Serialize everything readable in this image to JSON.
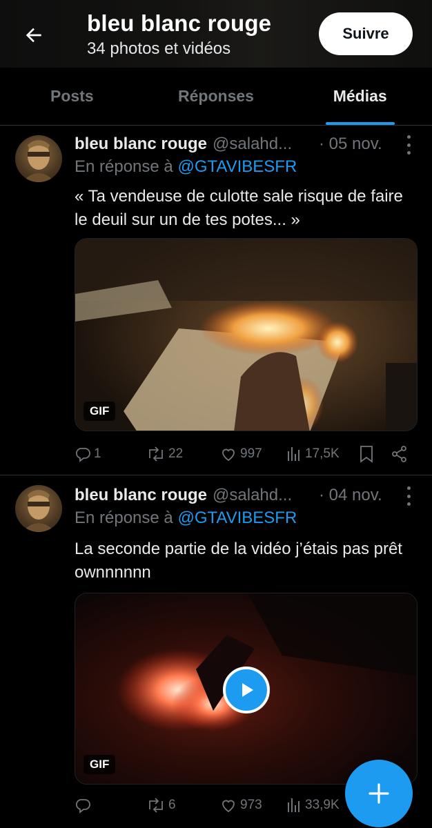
{
  "header": {
    "title": "bleu blanc rouge",
    "subtitle": "34 photos et vidéos",
    "follow_label": "Suivre"
  },
  "tabs": [
    {
      "label": "Posts",
      "active": false
    },
    {
      "label": "Réponses",
      "active": false
    },
    {
      "label": "Médias",
      "active": true
    }
  ],
  "tweets": [
    {
      "name": "bleu blanc rouge",
      "handle": "@salahd...",
      "date": "· 05 nov.",
      "reply_prefix": "En réponse à",
      "reply_to": "@GTAVIBESFR",
      "text": "« Ta vendeuse de culotte sale risque de faire le deuil sur un de tes potes... »",
      "media_badge": "GIF",
      "replies": "1",
      "reposts": "22",
      "likes": "997",
      "views": "17,5K"
    },
    {
      "name": "bleu blanc rouge",
      "handle": "@salahd...",
      "date": "· 04 nov.",
      "reply_prefix": "En réponse à",
      "reply_to": "@GTAVIBESFR",
      "text": "La seconde partie de la vidéo j’étais pas prêt ownnnnnn",
      "media_badge": "GIF",
      "replies": "",
      "reposts": "6",
      "likes": "973",
      "views": "33,9K"
    }
  ],
  "colors": {
    "accent": "#1d9bf0",
    "muted": "#71767b",
    "text": "#e7e9ea",
    "background": "#000000"
  },
  "icons": [
    "back-arrow-icon",
    "more-icon",
    "reply-icon",
    "repost-icon",
    "like-icon",
    "views-icon",
    "bookmark-icon",
    "share-icon",
    "play-icon",
    "plus-icon"
  ]
}
